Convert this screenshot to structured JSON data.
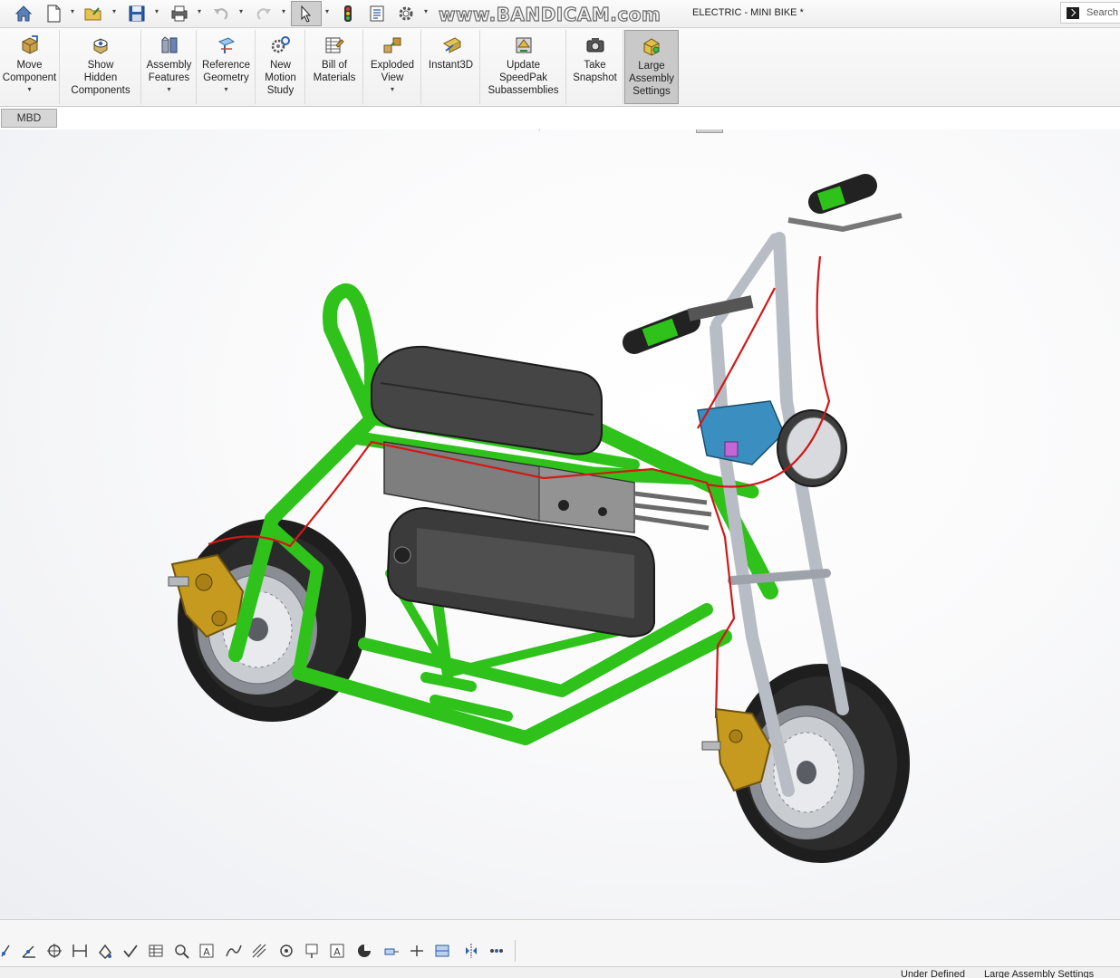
{
  "quick_access": {
    "watermark": "www.BANDICAM.com",
    "document_title": "ELECTRIC - MINI BIKE *",
    "search_label": "Search"
  },
  "command_manager": {
    "items": [
      {
        "label": "Move\nComponent",
        "icon": "move-component-icon",
        "dropdown": true
      },
      {
        "label": "Show\nHidden\nComponents",
        "icon": "show-hidden-icon",
        "dropdown": false
      },
      {
        "label": "Assembly\nFeatures",
        "icon": "assembly-features-icon",
        "dropdown": true
      },
      {
        "label": "Reference\nGeometry",
        "icon": "reference-geometry-icon",
        "dropdown": true
      },
      {
        "label": "New\nMotion\nStudy",
        "icon": "motion-study-icon",
        "dropdown": false
      },
      {
        "label": "Bill of\nMaterials",
        "icon": "bill-of-materials-icon",
        "dropdown": false
      },
      {
        "label": "Exploded\nView",
        "icon": "exploded-view-icon",
        "dropdown": true
      },
      {
        "label": "Instant3D",
        "icon": "instant3d-icon",
        "dropdown": false
      },
      {
        "label": "Update\nSpeedPak\nSubassemblies",
        "icon": "speedpak-icon",
        "dropdown": false
      },
      {
        "label": "Take\nSnapshot",
        "icon": "camera-icon",
        "dropdown": false
      },
      {
        "label": "Large\nAssembly\nSettings",
        "icon": "large-assembly-icon",
        "dropdown": false,
        "active": true
      }
    ]
  },
  "tabs": {
    "mbd": "MBD"
  },
  "status": {
    "state": "Under Defined",
    "mode": "Large Assembly Settings"
  },
  "colors": {
    "frame_green": "#2ec21a",
    "seat_dark": "#4a4a4a",
    "wire_red": "#d21818",
    "fork_silver": "#b8bcc4",
    "caliper_gold": "#c59a1e",
    "mount_blue": "#3a8fc0"
  }
}
